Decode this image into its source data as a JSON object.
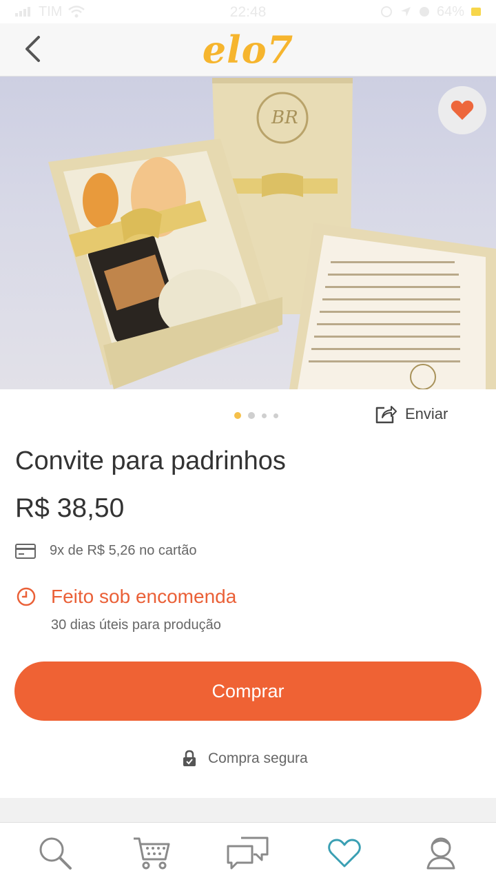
{
  "status_bar": {
    "carrier": "TIM",
    "time": "22:48",
    "battery": "64%"
  },
  "header": {
    "logo": "elo7"
  },
  "gallery": {
    "image_alt": "Convite para padrinhos",
    "total_images": 4,
    "active_index": 0
  },
  "share": {
    "label": "Enviar"
  },
  "product": {
    "title": "Convite para padrinhos",
    "price": "R$ 38,50",
    "installments": "9x de R$ 5,26 no cartão",
    "made_to_order": "Feito sob encomenda",
    "production_time": "30 dias úteis para produção"
  },
  "actions": {
    "buy_label": "Comprar",
    "secure_label": "Compra segura"
  },
  "nav": {
    "items": [
      {
        "name": "search",
        "icon": "search-icon"
      },
      {
        "name": "cart",
        "icon": "cart-icon"
      },
      {
        "name": "messages",
        "icon": "chat-icon"
      },
      {
        "name": "favorites",
        "icon": "heart-icon"
      },
      {
        "name": "profile",
        "icon": "user-icon"
      }
    ]
  },
  "colors": {
    "accent": "#ef6234",
    "logo": "#f6b52e",
    "favorite_active": "#3a9fb3"
  }
}
